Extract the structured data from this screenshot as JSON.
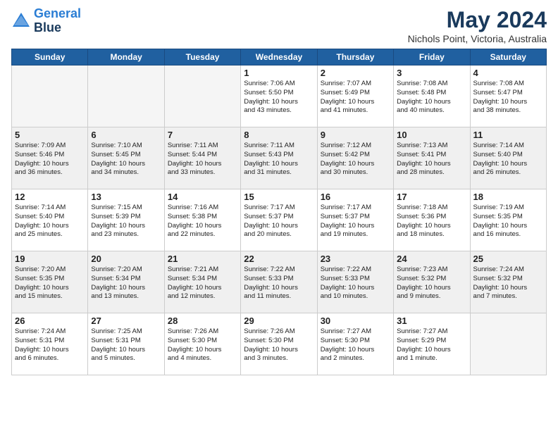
{
  "logo": {
    "line1": "General",
    "line2": "Blue"
  },
  "title": "May 2024",
  "subtitle": "Nichols Point, Victoria, Australia",
  "headers": [
    "Sunday",
    "Monday",
    "Tuesday",
    "Wednesday",
    "Thursday",
    "Friday",
    "Saturday"
  ],
  "weeks": [
    [
      {
        "day": "",
        "info": ""
      },
      {
        "day": "",
        "info": ""
      },
      {
        "day": "",
        "info": ""
      },
      {
        "day": "1",
        "info": "Sunrise: 7:06 AM\nSunset: 5:50 PM\nDaylight: 10 hours\nand 43 minutes."
      },
      {
        "day": "2",
        "info": "Sunrise: 7:07 AM\nSunset: 5:49 PM\nDaylight: 10 hours\nand 41 minutes."
      },
      {
        "day": "3",
        "info": "Sunrise: 7:08 AM\nSunset: 5:48 PM\nDaylight: 10 hours\nand 40 minutes."
      },
      {
        "day": "4",
        "info": "Sunrise: 7:08 AM\nSunset: 5:47 PM\nDaylight: 10 hours\nand 38 minutes."
      }
    ],
    [
      {
        "day": "5",
        "info": "Sunrise: 7:09 AM\nSunset: 5:46 PM\nDaylight: 10 hours\nand 36 minutes."
      },
      {
        "day": "6",
        "info": "Sunrise: 7:10 AM\nSunset: 5:45 PM\nDaylight: 10 hours\nand 34 minutes."
      },
      {
        "day": "7",
        "info": "Sunrise: 7:11 AM\nSunset: 5:44 PM\nDaylight: 10 hours\nand 33 minutes."
      },
      {
        "day": "8",
        "info": "Sunrise: 7:11 AM\nSunset: 5:43 PM\nDaylight: 10 hours\nand 31 minutes."
      },
      {
        "day": "9",
        "info": "Sunrise: 7:12 AM\nSunset: 5:42 PM\nDaylight: 10 hours\nand 30 minutes."
      },
      {
        "day": "10",
        "info": "Sunrise: 7:13 AM\nSunset: 5:41 PM\nDaylight: 10 hours\nand 28 minutes."
      },
      {
        "day": "11",
        "info": "Sunrise: 7:14 AM\nSunset: 5:40 PM\nDaylight: 10 hours\nand 26 minutes."
      }
    ],
    [
      {
        "day": "12",
        "info": "Sunrise: 7:14 AM\nSunset: 5:40 PM\nDaylight: 10 hours\nand 25 minutes."
      },
      {
        "day": "13",
        "info": "Sunrise: 7:15 AM\nSunset: 5:39 PM\nDaylight: 10 hours\nand 23 minutes."
      },
      {
        "day": "14",
        "info": "Sunrise: 7:16 AM\nSunset: 5:38 PM\nDaylight: 10 hours\nand 22 minutes."
      },
      {
        "day": "15",
        "info": "Sunrise: 7:17 AM\nSunset: 5:37 PM\nDaylight: 10 hours\nand 20 minutes."
      },
      {
        "day": "16",
        "info": "Sunrise: 7:17 AM\nSunset: 5:37 PM\nDaylight: 10 hours\nand 19 minutes."
      },
      {
        "day": "17",
        "info": "Sunrise: 7:18 AM\nSunset: 5:36 PM\nDaylight: 10 hours\nand 18 minutes."
      },
      {
        "day": "18",
        "info": "Sunrise: 7:19 AM\nSunset: 5:35 PM\nDaylight: 10 hours\nand 16 minutes."
      }
    ],
    [
      {
        "day": "19",
        "info": "Sunrise: 7:20 AM\nSunset: 5:35 PM\nDaylight: 10 hours\nand 15 minutes."
      },
      {
        "day": "20",
        "info": "Sunrise: 7:20 AM\nSunset: 5:34 PM\nDaylight: 10 hours\nand 13 minutes."
      },
      {
        "day": "21",
        "info": "Sunrise: 7:21 AM\nSunset: 5:34 PM\nDaylight: 10 hours\nand 12 minutes."
      },
      {
        "day": "22",
        "info": "Sunrise: 7:22 AM\nSunset: 5:33 PM\nDaylight: 10 hours\nand 11 minutes."
      },
      {
        "day": "23",
        "info": "Sunrise: 7:22 AM\nSunset: 5:33 PM\nDaylight: 10 hours\nand 10 minutes."
      },
      {
        "day": "24",
        "info": "Sunrise: 7:23 AM\nSunset: 5:32 PM\nDaylight: 10 hours\nand 9 minutes."
      },
      {
        "day": "25",
        "info": "Sunrise: 7:24 AM\nSunset: 5:32 PM\nDaylight: 10 hours\nand 7 minutes."
      }
    ],
    [
      {
        "day": "26",
        "info": "Sunrise: 7:24 AM\nSunset: 5:31 PM\nDaylight: 10 hours\nand 6 minutes."
      },
      {
        "day": "27",
        "info": "Sunrise: 7:25 AM\nSunset: 5:31 PM\nDaylight: 10 hours\nand 5 minutes."
      },
      {
        "day": "28",
        "info": "Sunrise: 7:26 AM\nSunset: 5:30 PM\nDaylight: 10 hours\nand 4 minutes."
      },
      {
        "day": "29",
        "info": "Sunrise: 7:26 AM\nSunset: 5:30 PM\nDaylight: 10 hours\nand 3 minutes."
      },
      {
        "day": "30",
        "info": "Sunrise: 7:27 AM\nSunset: 5:30 PM\nDaylight: 10 hours\nand 2 minutes."
      },
      {
        "day": "31",
        "info": "Sunrise: 7:27 AM\nSunset: 5:29 PM\nDaylight: 10 hours\nand 1 minute."
      },
      {
        "day": "",
        "info": ""
      }
    ]
  ]
}
